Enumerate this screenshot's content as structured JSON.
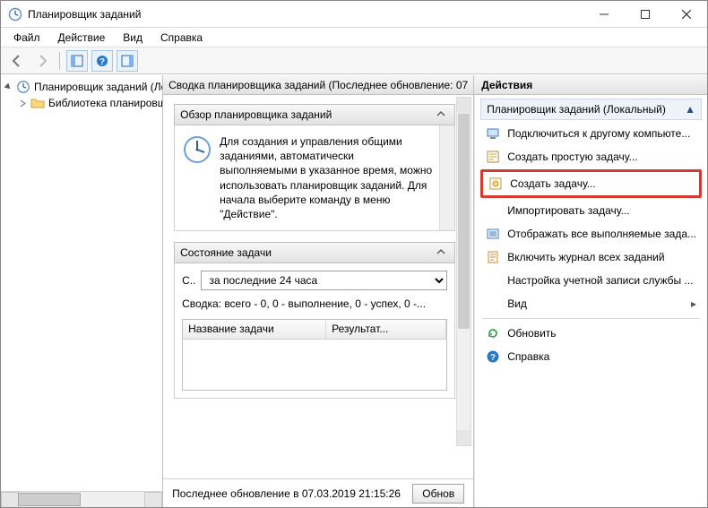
{
  "window": {
    "title": "Планировщик заданий"
  },
  "menu": {
    "file": "Файл",
    "action": "Действие",
    "view": "Вид",
    "help": "Справка"
  },
  "tree": {
    "root": "Планировщик заданий (Лок",
    "lib": "Библиотека планировщ"
  },
  "center": {
    "header": "Сводка планировщика заданий (Последнее обновление: 07",
    "overview_title": "Обзор планировщика заданий",
    "overview_text": "Для создания и управления общими заданиями, автоматически выполняемыми в указанное время, можно использовать планировщик заданий. Для начала выберите команду в меню \"Действие\".",
    "status_title": "Состояние задачи",
    "status_prefix": "С..",
    "status_period": "за последние 24 часа",
    "summary": "Сводка: всего - 0, 0 - выполнение, 0 - успех, 0 -...",
    "table": {
      "col1": "Название задачи",
      "col2": "Результат..."
    },
    "last_update": "Последнее обновление в 07.03.2019 21:15:26",
    "refresh_btn": "Обнов"
  },
  "actions": {
    "title": "Действия",
    "subtitle": "Планировщик заданий (Локальный)",
    "items": {
      "connect": "Подключиться к другому компьюте...",
      "create_basic": "Создать простую задачу...",
      "create_task": "Создать задачу...",
      "import_task": "Импортировать задачу...",
      "show_running": "Отображать все выполняемые зада...",
      "enable_history": "Включить журнал всех заданий",
      "account_settings": "Настройка учетной записи службы ...",
      "view": "Вид",
      "refresh": "Обновить",
      "help": "Справка"
    }
  }
}
